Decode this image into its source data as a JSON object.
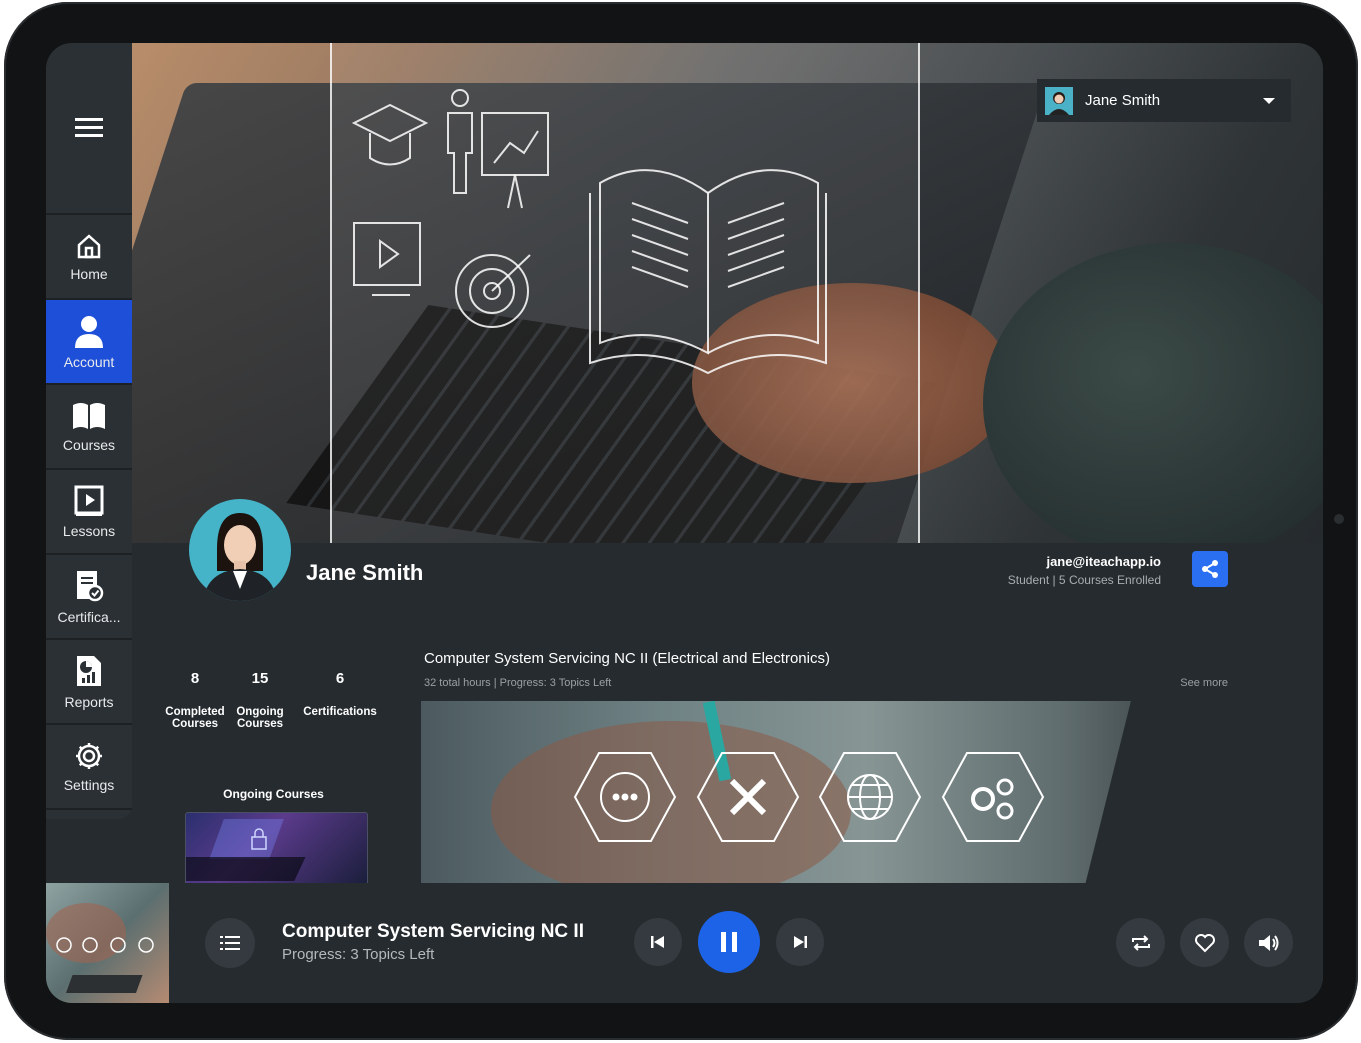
{
  "user": {
    "name": "Jane Smith",
    "email": "jane@iteachapp.io",
    "role_line": "Student | 5 Courses Enrolled"
  },
  "sidebar": {
    "items": [
      {
        "label": "Home",
        "icon": "home-icon"
      },
      {
        "label": "Account",
        "icon": "user-icon",
        "active": true
      },
      {
        "label": "Courses",
        "icon": "book-icon"
      },
      {
        "label": "Lessons",
        "icon": "video-lesson-icon"
      },
      {
        "label": "Certifica...",
        "icon": "certificate-icon"
      },
      {
        "label": "Reports",
        "icon": "report-icon"
      },
      {
        "label": "Settings",
        "icon": "gear-icon"
      }
    ]
  },
  "stats": [
    {
      "value": "8",
      "label": "Completed Courses"
    },
    {
      "value": "15",
      "label": "Ongoing Courses"
    },
    {
      "value": "6",
      "label": "Certifications"
    }
  ],
  "ongoing": {
    "title": "Ongoing Courses"
  },
  "course": {
    "title": "Computer System Servicing NC II (Electrical and Electronics)",
    "meta": "32 total hours | Progress: 3 Topics Left",
    "see_more": "See more"
  },
  "player": {
    "title": "Computer System Servicing NC II",
    "subtitle": "Progress: 3 Topics Left"
  },
  "colors": {
    "accent": "#1e4fd8",
    "play": "#1d63e8",
    "share": "#2a6ef2",
    "panel": "#262b2f"
  }
}
